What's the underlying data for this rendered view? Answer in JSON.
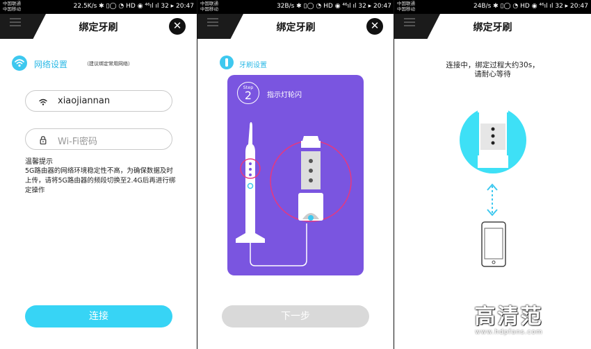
{
  "status": {
    "carrier1": "中国联通",
    "carrier2": "中国移动",
    "panel1_right": "22.5K/s ✱ ▯◯ ◔ HD ◉ ⁴⁶ıl ıl 32 ▸ 20:47",
    "panel2_right": "32B/s ✱ ▯◯ ◔ HD ◉ ⁴⁶ıl ıl 32 ▸ 20:47",
    "panel3_right": "24B/s ✱ ▯◯ ◔ HD ◉ ⁴⁶ıl ıl 32 ▸ 20:47"
  },
  "panel1": {
    "title": "绑定牙刷",
    "section_title": "网络设置",
    "section_note": "（建议绑定常用网络）",
    "wifi_name": "xiaojiannan",
    "password_placeholder": "Wi-Fi密码",
    "tips_title": "温馨提示",
    "tips_body": "5G路由器的网络环境稳定性不高，为确保数据及时上传，请将5G路由器的频段切换至2.4G后再进行绑定操作",
    "connect_label": "连接"
  },
  "panel2": {
    "title": "绑定牙刷",
    "section_title": "牙刷设置",
    "step_word": "Step",
    "step_number": "2",
    "card_caption": "指示灯轮闪",
    "next_label": "下一步"
  },
  "panel3": {
    "title": "绑定牙刷",
    "wait_line1": "连接中，绑定过程大约30s，",
    "wait_line2": "请耐心等待"
  },
  "watermark": {
    "main": "高清范",
    "url": "www.hdpfans.com"
  },
  "colors": {
    "accent": "#37d4f5",
    "accent_text": "#2cb9e6",
    "card_purple": "#7a55e0",
    "highlight_pink": "#e8377d",
    "disabled": "#d9d9d9"
  },
  "icons": [
    "menu-icon",
    "close-icon",
    "wifi-icon",
    "lock-icon",
    "toothbrush-icon",
    "phone-icon",
    "double-arrow-icon"
  ]
}
